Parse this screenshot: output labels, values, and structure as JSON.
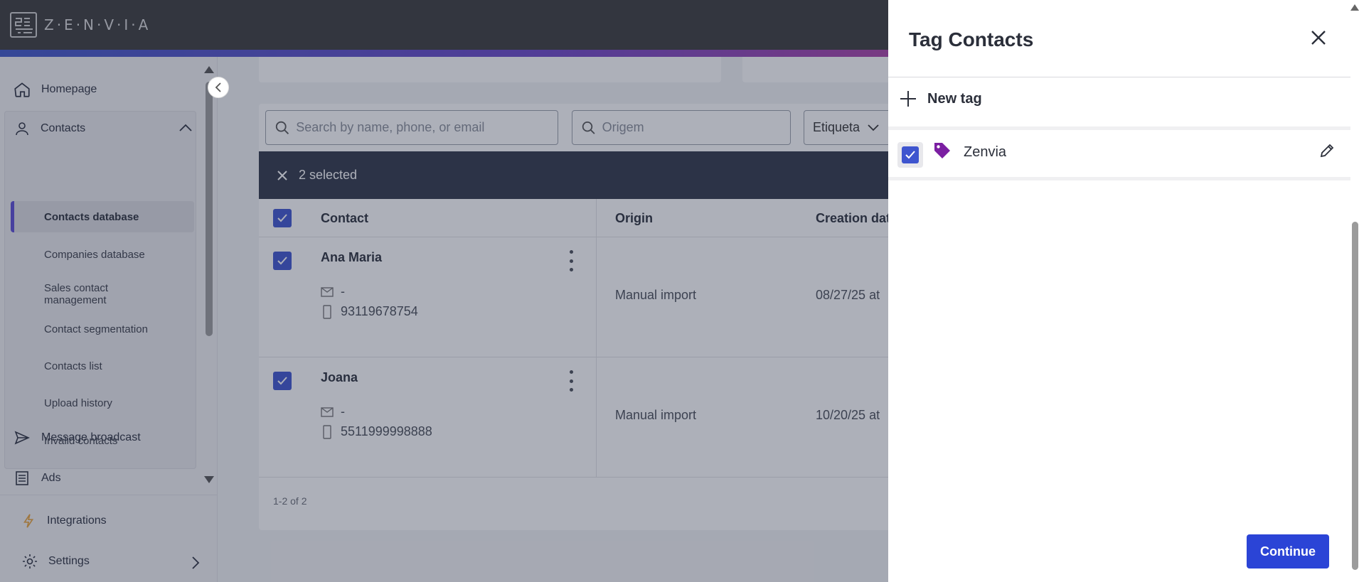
{
  "app": {
    "logo_text": "Z·E·N·V·I·A"
  },
  "sidebar": {
    "homepage": "Homepage",
    "contacts": "Contacts",
    "contacts_items": [
      "Contacts database",
      "Companies database",
      "Sales contact management",
      "Contact segmentation",
      "Contacts list",
      "Upload history",
      "Invalid contacts"
    ],
    "message_broadcast": "Message broadcast",
    "ads": "Ads",
    "integrations": "Integrations",
    "settings": "Settings"
  },
  "filters": {
    "search_placeholder": "Search by name, phone, or email",
    "origin_placeholder": "Origem",
    "tag_dropdown": "Etiqueta"
  },
  "selection": {
    "count_label": "2 selected"
  },
  "table": {
    "headers": [
      "Contact",
      "Origin",
      "Creation dat"
    ],
    "rows": [
      {
        "name": "Ana Maria",
        "email": "-",
        "phone": "93119678754",
        "origin": "Manual import",
        "date": "08/27/25 at"
      },
      {
        "name": "Joana",
        "email": "-",
        "phone": "5511999998888",
        "origin": "Manual import",
        "date": "10/20/25 at"
      }
    ],
    "pagination": "1-2 of 2"
  },
  "drawer": {
    "title": "Tag Contacts",
    "new_tag_label": "New tag",
    "tags": [
      {
        "name": "Zenvia",
        "checked": true,
        "color": "#7b1fa2"
      }
    ],
    "continue_label": "Continue"
  },
  "colors": {
    "accent": "#2b44d6",
    "checkbox": "#3e55cf",
    "selection_bar": "#2f3648",
    "active_indicator": "#5b4bd6"
  }
}
